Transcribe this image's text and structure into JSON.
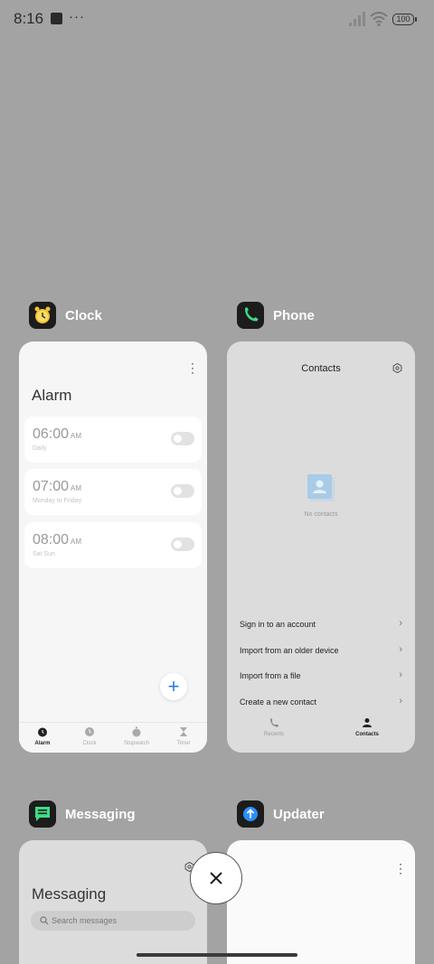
{
  "status_bar": {
    "time": "8:16",
    "dots": "···",
    "battery": "100"
  },
  "apps": {
    "clock": {
      "name": "Clock",
      "title": "Alarm",
      "alarms": [
        {
          "time": "06:00",
          "ampm": "AM",
          "repeat": "Daily",
          "enabled": false
        },
        {
          "time": "07:00",
          "ampm": "AM",
          "repeat": "Monday to Friday",
          "enabled": false
        },
        {
          "time": "08:00",
          "ampm": "AM",
          "repeat": "Sat Sun",
          "enabled": false
        }
      ],
      "nav": [
        "Alarm",
        "Clock",
        "Stopwatch",
        "Timer"
      ],
      "accent": "#2a7fd4"
    },
    "phone": {
      "name": "Phone",
      "title": "Contacts",
      "empty_text": "No contacts",
      "menu": [
        "Sign in to an account",
        "Import from an older device",
        "Import from a file",
        "Create a new contact"
      ],
      "nav": [
        "Recents",
        "Contacts"
      ]
    },
    "messaging": {
      "name": "Messaging",
      "title": "Messaging",
      "search_placeholder": "Search messages"
    },
    "updater": {
      "name": "Updater"
    }
  },
  "icons": {
    "close": "close-icon",
    "clock_app": "alarm-clock-icon",
    "phone_app": "phone-icon",
    "messaging_app": "chat-icon",
    "updater_app": "arrow-up-icon"
  }
}
